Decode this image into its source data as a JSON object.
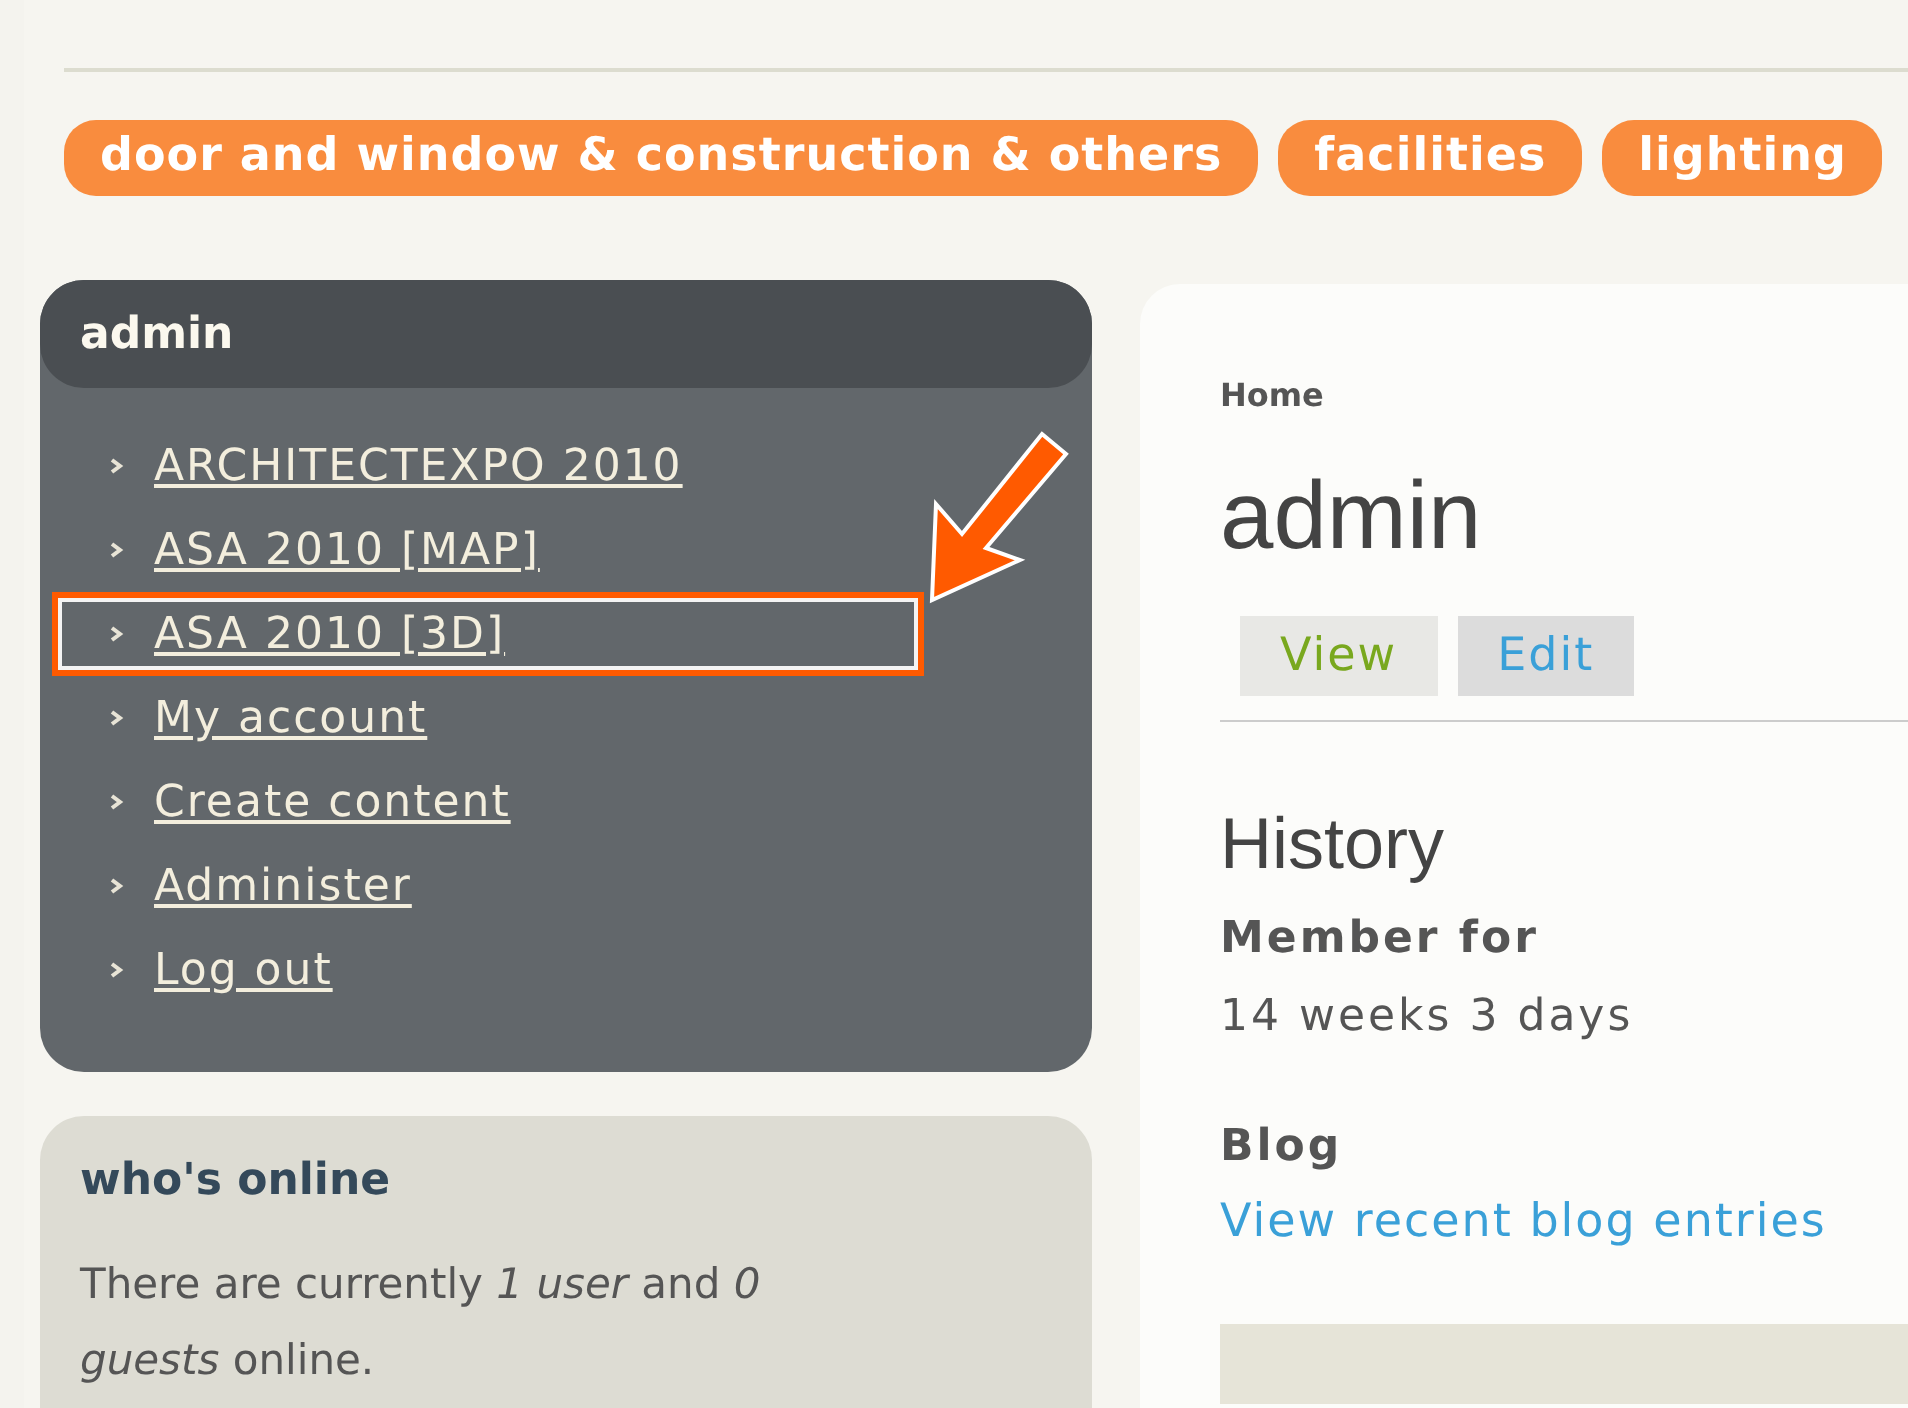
{
  "categories": [
    {
      "label": "door and window & construction & others"
    },
    {
      "label": "facilities"
    },
    {
      "label": "lighting"
    }
  ],
  "user_block": {
    "title": "admin",
    "items": [
      {
        "label": "ARCHITECTEXPO 2010",
        "highlighted": false
      },
      {
        "label": "ASA 2010 [MAP]",
        "highlighted": false
      },
      {
        "label": "ASA 2010 [3D]",
        "highlighted": true
      },
      {
        "label": "My account",
        "highlighted": false
      },
      {
        "label": "Create content",
        "highlighted": false
      },
      {
        "label": "Administer",
        "highlighted": false
      },
      {
        "label": "Log out",
        "highlighted": false
      }
    ]
  },
  "whos_online": {
    "title": "who's online",
    "text": "There are currently *1 user* and *0 guests* online."
  },
  "content": {
    "breadcrumb": "Home",
    "title": "admin",
    "tabs": [
      {
        "label": "View",
        "selected": true
      },
      {
        "label": "Edit",
        "selected": false
      }
    ],
    "section_title": "History",
    "fields": [
      {
        "label": "Member for",
        "value": "14 weeks 3 days",
        "kind": "text"
      },
      {
        "label": "Blog",
        "value": "View recent blog entries",
        "kind": "link"
      }
    ]
  }
}
